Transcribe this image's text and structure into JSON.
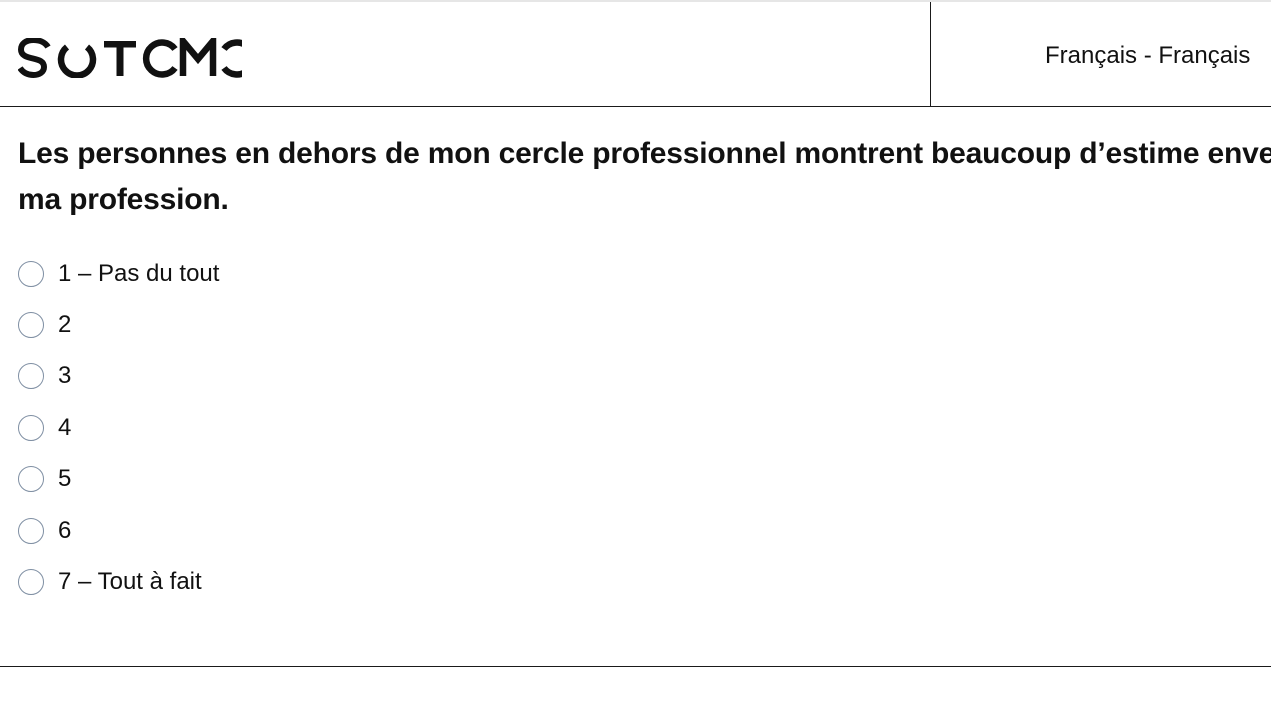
{
  "header": {
    "logo_text": "SOTOMO",
    "language_selector": "Français - Français"
  },
  "question": {
    "text": "Les personnes en dehors de mon cercle professionnel montrent beaucoup d’estime envers ma profession."
  },
  "options": [
    {
      "label": "1 – Pas du tout",
      "selected": false
    },
    {
      "label": "2",
      "selected": false
    },
    {
      "label": "3",
      "selected": false
    },
    {
      "label": "4",
      "selected": false
    },
    {
      "label": "5",
      "selected": false
    },
    {
      "label": "6",
      "selected": false
    },
    {
      "label": "7 – Tout à fait",
      "selected": false
    }
  ],
  "colors": {
    "text": "#111111",
    "radio_border": "#7f8fa3",
    "divider": "#1a1a1a"
  }
}
